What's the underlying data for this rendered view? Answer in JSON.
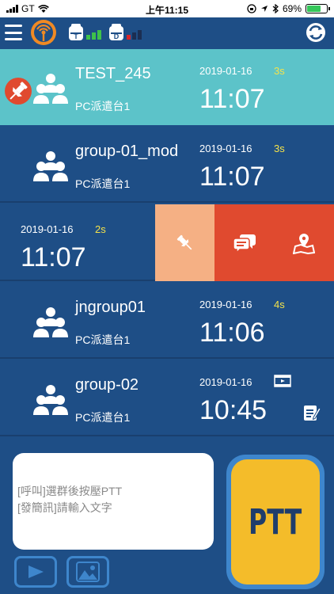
{
  "status_bar": {
    "carrier": "GT",
    "time": "上午11:15",
    "battery": "69%",
    "battery_level": 0.69
  },
  "header": {
    "icons": [
      "menu-icon",
      "radar-icon",
      "device-t-status-icon",
      "device-d-status-icon",
      "sync-icon"
    ],
    "badge_t": "T",
    "badge_d": "D"
  },
  "groups": [
    {
      "name": "TEST_245",
      "subtitle": "PC派遣台1",
      "date": "2019-01-16",
      "duration": "3s",
      "time": "11:07",
      "active": true,
      "pinned": true
    },
    {
      "name": "group-01_mod",
      "subtitle": "PC派遣台1",
      "date": "2019-01-16",
      "duration": "3s",
      "time": "11:07"
    },
    {
      "name": "jngroup01",
      "subtitle": "PC派遣台1",
      "date": "2019-01-16",
      "duration": "4s",
      "time": "11:06"
    },
    {
      "name": "group-02",
      "subtitle": "PC派遣台1",
      "date": "2019-01-16",
      "time": "10:45",
      "has_video": true,
      "has_note": true
    }
  ],
  "swiped_row": {
    "date": "2019-01-16",
    "duration": "2s",
    "time": "11:07",
    "actions": [
      "pin-icon",
      "message-icon",
      "map-icon"
    ]
  },
  "bottom": {
    "hint_call": "[呼叫]選群後按壓PTT",
    "hint_sms": "[發簡訊]請輸入文字",
    "ptt_label": "PTT"
  },
  "colors": {
    "background": "#1e4e86",
    "active_row": "#5cc3c9",
    "duration_text": "#f4e24a",
    "swipe_pin": "#f5b084",
    "swipe_red": "#e04a2f",
    "ptt_yellow": "#f4bc2a",
    "ptt_border": "#3e86cc"
  }
}
